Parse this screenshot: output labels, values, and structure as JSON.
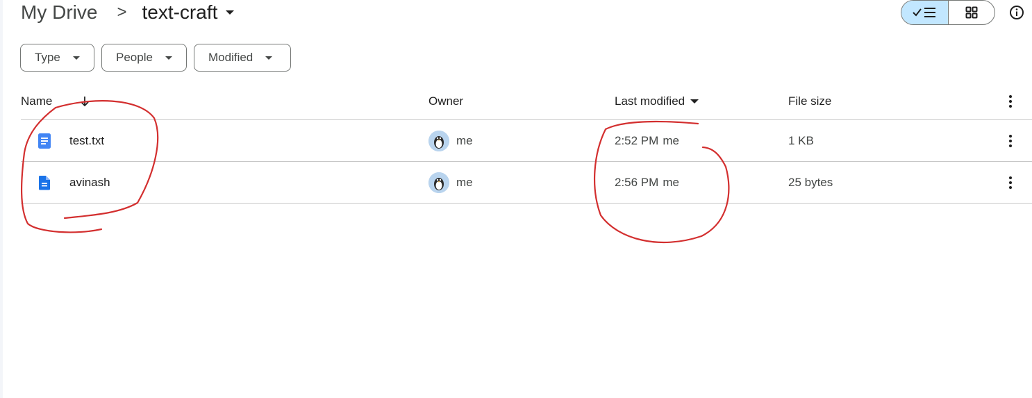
{
  "breadcrumb": {
    "root": "My Drive",
    "separator": ">",
    "current": "text-craft"
  },
  "toolbar": {
    "list_view_icon": "check-list-icon",
    "grid_view_icon": "grid-icon",
    "info_icon": "info-icon",
    "active_view": "list"
  },
  "filters": [
    {
      "label": "Type"
    },
    {
      "label": "People"
    },
    {
      "label": "Modified"
    }
  ],
  "table": {
    "columns": {
      "name": "Name",
      "owner": "Owner",
      "last_modified": "Last modified",
      "file_size": "File size"
    },
    "rows": [
      {
        "name": "test.txt",
        "icon": "google-doc-icon",
        "owner": "me",
        "modified_time": "2:52 PM",
        "modified_by": "me",
        "size": "1 KB"
      },
      {
        "name": "avinash",
        "icon": "file-text-icon",
        "owner": "me",
        "modified_time": "2:56 PM",
        "modified_by": "me",
        "size": "25 bytes"
      }
    ]
  },
  "colors": {
    "accent_toggle": "#c2e7ff",
    "doc_blue": "#4285f4",
    "file_blue": "#1a73e8",
    "annotation_red": "#d32f2f"
  }
}
